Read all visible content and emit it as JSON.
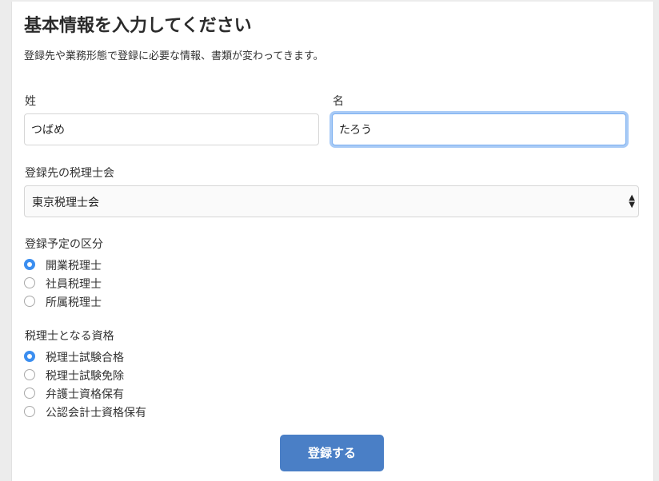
{
  "form": {
    "title": "基本情報を入力してください",
    "description": "登録先や業務形態で登録に必要な情報、書類が変わってきます。",
    "last_name": {
      "label": "姓",
      "value": "つばめ"
    },
    "first_name": {
      "label": "名",
      "value": "たろう"
    },
    "association": {
      "label": "登録先の税理士会",
      "selected": "東京税理士会"
    },
    "category": {
      "label": "登録予定の区分",
      "options": [
        {
          "label": "開業税理士",
          "checked": true
        },
        {
          "label": "社員税理士",
          "checked": false
        },
        {
          "label": "所属税理士",
          "checked": false
        }
      ]
    },
    "qualification": {
      "label": "税理士となる資格",
      "options": [
        {
          "label": "税理士試験合格",
          "checked": true
        },
        {
          "label": "税理士試験免除",
          "checked": false
        },
        {
          "label": "弁護士資格保有",
          "checked": false
        },
        {
          "label": "公認会計士資格保有",
          "checked": false
        }
      ]
    },
    "submit_label": "登録する"
  },
  "colors": {
    "accent": "#3b8ef0",
    "button": "#4a7fc6",
    "focus_ring": "#a9cbf6"
  }
}
